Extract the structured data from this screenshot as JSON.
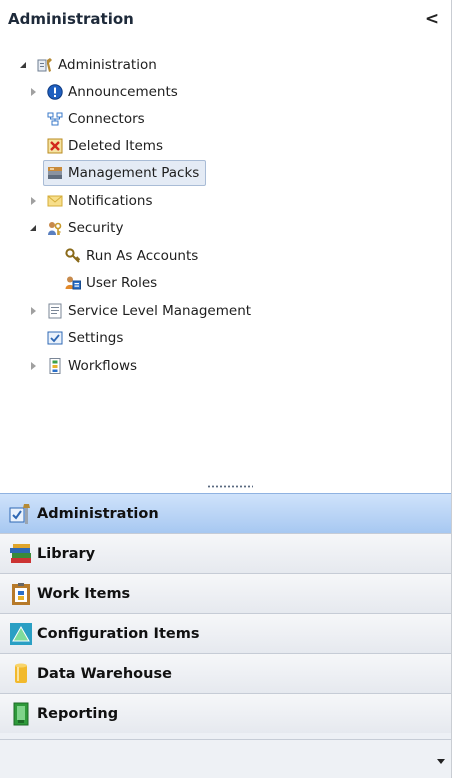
{
  "header": {
    "title": "Administration",
    "collapse_glyph": "<"
  },
  "tree": {
    "root": {
      "label": "Administration",
      "icon": "administration-icon"
    },
    "items": [
      {
        "label": "Announcements",
        "icon": "info-icon"
      },
      {
        "label": "Connectors",
        "icon": "connectors-icon"
      },
      {
        "label": "Deleted Items",
        "icon": "deleted-items-icon"
      },
      {
        "label": "Management Packs",
        "icon": "management-packs-icon",
        "selected": true
      },
      {
        "label": "Notifications",
        "icon": "envelope-icon"
      },
      {
        "label": "Security",
        "icon": "security-icon"
      },
      {
        "label": "Run As Accounts",
        "icon": "key-icon"
      },
      {
        "label": "User Roles",
        "icon": "user-roles-icon"
      },
      {
        "label": "Service Level Management",
        "icon": "document-icon"
      },
      {
        "label": "Settings",
        "icon": "settings-check-icon"
      },
      {
        "label": "Workflows",
        "icon": "workflow-icon"
      }
    ]
  },
  "nav": {
    "buttons": [
      {
        "label": "Administration",
        "icon": "administration-nav-icon",
        "active": true
      },
      {
        "label": "Library",
        "icon": "books-icon"
      },
      {
        "label": "Work Items",
        "icon": "clipboard-icon"
      },
      {
        "label": "Configuration Items",
        "icon": "triangle-icon"
      },
      {
        "label": "Data Warehouse",
        "icon": "database-icon"
      },
      {
        "label": "Reporting",
        "icon": "report-icon"
      }
    ]
  },
  "colors": {
    "active_nav": "#a7c8f1",
    "selected_item": "#e4ebf5",
    "accent": "#2a6fc9"
  }
}
